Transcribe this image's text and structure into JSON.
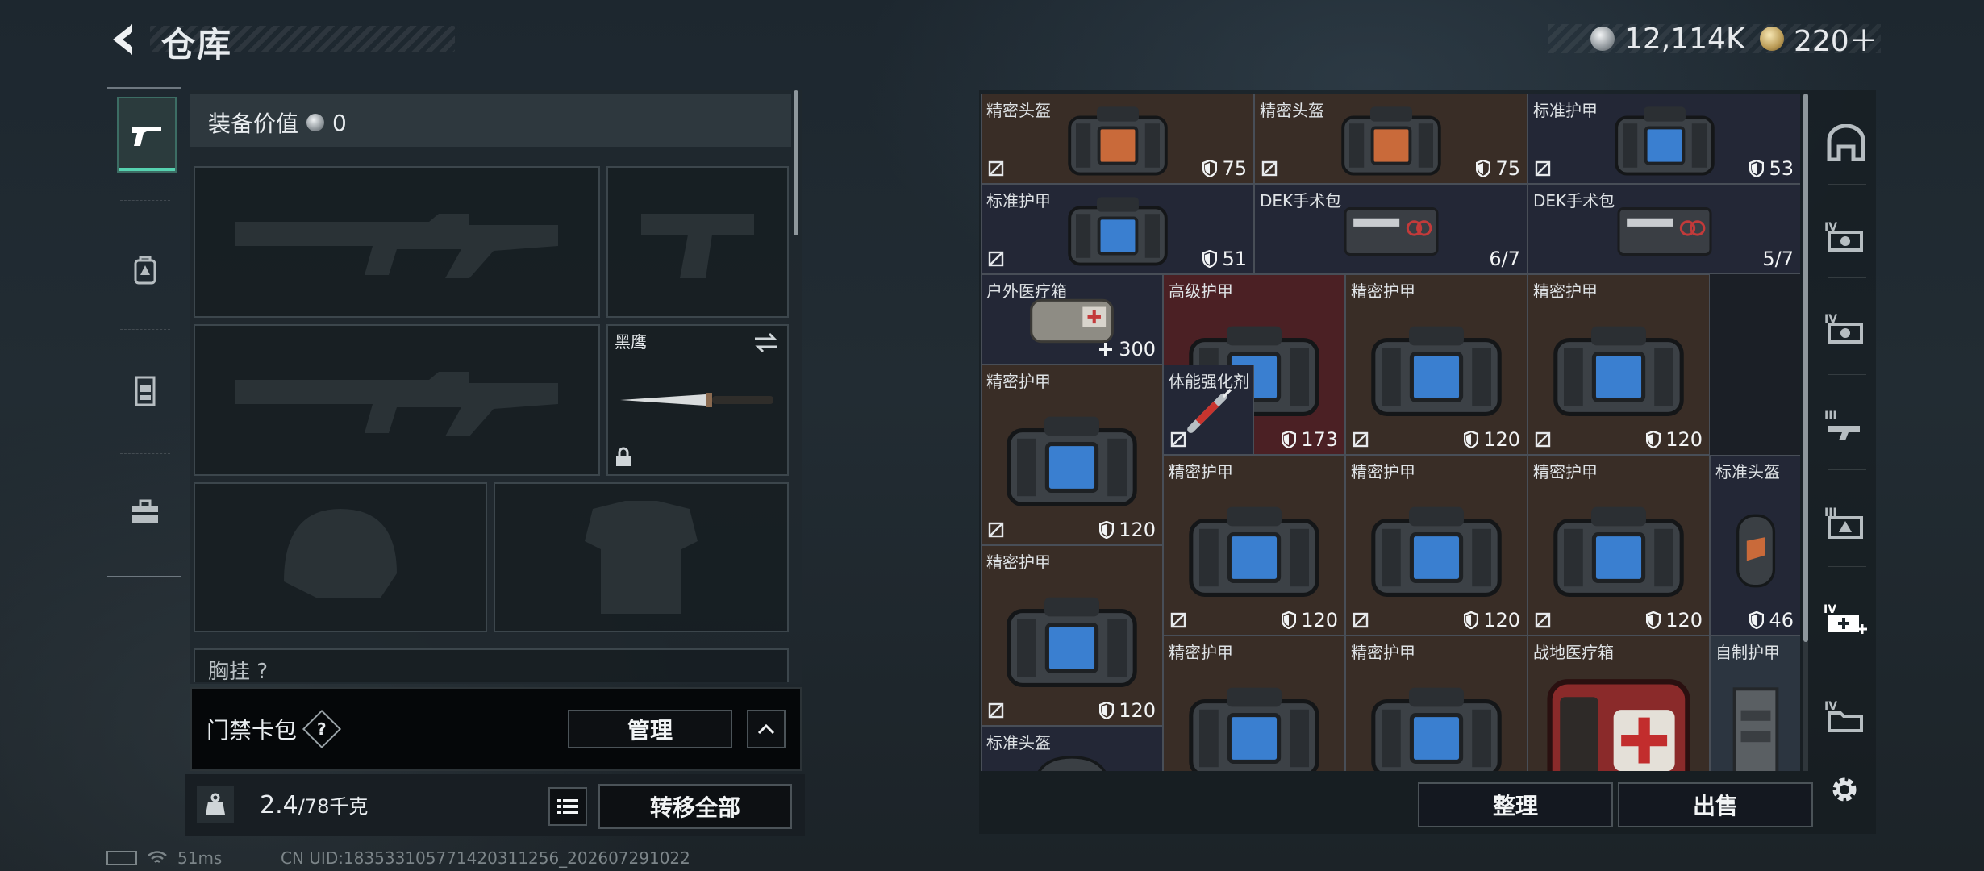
{
  "header": {
    "title": "仓库",
    "currency_1": "12,114K",
    "currency_2": "220＋"
  },
  "equipment": {
    "value_label": "装备价值",
    "value": "0",
    "knife_label": "黑鹰",
    "chest_label": "胸挂 ?",
    "keycard_label": "门禁卡包",
    "keycard_help": "?",
    "manage_label": "管理",
    "weight_value": "2.4",
    "weight_capacity": "/78千克",
    "transfer_all_label": "转移全部"
  },
  "stash": {
    "items": [
      {
        "name": "精密头盔",
        "value": "75",
        "kind": "shield"
      },
      {
        "name": "精密头盔",
        "value": "75",
        "kind": "shield"
      },
      {
        "name": "标准护甲",
        "value": "53",
        "kind": "shield"
      },
      {
        "name": "标准护甲",
        "value": "51",
        "kind": "shield"
      },
      {
        "name": "DEK手术包",
        "value": "6/7",
        "kind": "count"
      },
      {
        "name": "DEK手术包",
        "value": "5/7",
        "kind": "count"
      },
      {
        "name": "户外医疗箱",
        "value": "300",
        "kind": "heal"
      },
      {
        "name": "高级护甲",
        "value": "173",
        "kind": "shield"
      },
      {
        "name": "精密护甲",
        "value": "120",
        "kind": "shield"
      },
      {
        "name": "精密护甲",
        "value": "120",
        "kind": "shield"
      },
      {
        "name": "精密护甲",
        "value": "120",
        "kind": "shield"
      },
      {
        "name": "体能强化剂",
        "value": "",
        "kind": "none"
      },
      {
        "name": "精密护甲",
        "value": "120",
        "kind": "shield"
      },
      {
        "name": "精密护甲",
        "value": "120",
        "kind": "shield"
      },
      {
        "name": "精密护甲",
        "value": "120",
        "kind": "shield"
      },
      {
        "name": "标准头盔",
        "value": "46",
        "kind": "shield"
      },
      {
        "name": "精密护甲",
        "value": "120",
        "kind": "shield"
      },
      {
        "name": "精密护甲",
        "value": "",
        "kind": "none"
      },
      {
        "name": "精密护甲",
        "value": "",
        "kind": "none"
      },
      {
        "name": "战地医疗箱",
        "value": "",
        "kind": "none"
      },
      {
        "name": "自制护甲",
        "value": "",
        "kind": "none"
      },
      {
        "name": "标准头盔",
        "value": "",
        "kind": "none"
      }
    ],
    "sort_label": "整理",
    "sell_label": "出售"
  },
  "status": {
    "ping": "51ms",
    "uid": "CN UID:183533105771420311256_202607291022"
  },
  "colors": {
    "accent": "#56d2b0",
    "brown_cell": "#392d26",
    "navy_cell": "#232736",
    "red_cell": "#4b2024"
  },
  "icons": [
    "back-arrow-icon",
    "silver-coin-icon",
    "gold-coin-icon",
    "pistol-icon",
    "backpack-icon",
    "vest-icon",
    "toolbox-icon",
    "swap-icon",
    "lock-icon",
    "help-icon",
    "chevron-up-icon",
    "weight-icon",
    "list-icon",
    "shield-icon",
    "plus-icon",
    "no-mod-icon",
    "gear-icon",
    "battery-icon",
    "wifi-icon"
  ]
}
